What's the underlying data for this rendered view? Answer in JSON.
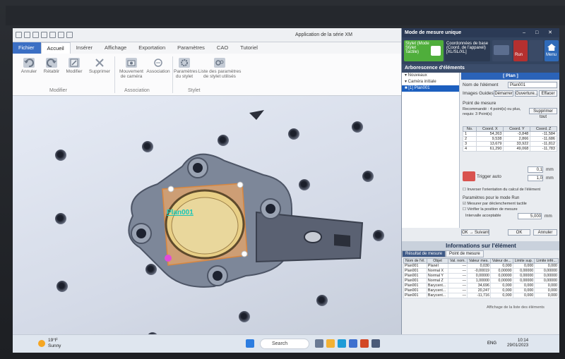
{
  "window": {
    "title": "Application de la série XM"
  },
  "ribbon": {
    "tabs": [
      "Fichier",
      "Accueil",
      "Insérer",
      "Affichage",
      "Exportation",
      "Paramètres",
      "CAO",
      "Tutoriel"
    ],
    "active_tab": "Accueil",
    "buttons": {
      "annuler": "Annuler",
      "retablir": "Rétablir",
      "modifier": "Modifier",
      "supprimer": "Supprimer",
      "mouvement_camera": "Mouvement de caméra",
      "association": "Association",
      "param_stylet": "Paramètres du stylet",
      "liste_param": "Liste des paramètres de stylet utilisés"
    },
    "groups": {
      "modifier": "Modifier",
      "association": "Association",
      "stylet": "Stylet"
    }
  },
  "viewport": {
    "element_label": "Plan001"
  },
  "panel": {
    "title": "Mode de mesure unique",
    "controls": "–  □  ✕",
    "tools": {
      "stylet_label": "Stylet (Mode Stylet Tactile)",
      "coords_label": "Coordonnées de base (Coord. de l'appareil) [XL/SL/XL]",
      "run": "Run",
      "menu": "Menu"
    },
    "tree_header": "Arborescence d'éléments",
    "tree": [
      "▾ Nouveaux",
      "   ▾ Caméra initiale",
      "      ■ [1] Plan001"
    ],
    "element_type": "[ Plan ]",
    "labels": {
      "nom": "Nom de l'élément",
      "nom_value": "Plan001",
      "guides": "Images Guides",
      "guide_btns": [
        "Démarrer",
        "Ouverture...",
        "Effacer"
      ],
      "point": "Point de mesure",
      "recommande": "Recommandé : 4 point(s) ou plus, requis: 3 Point(s)",
      "suppr": "Supprimer tout",
      "trigger": "Trigger auto",
      "inverser": "Inverser l'orientation du calcul de l'élément",
      "run_params": "Paramètres pour le mode Run",
      "mesurer": "Mesurer par déclenchement tactile",
      "verifier": "Vérifier la position de mesure",
      "intervalle": "Intervalle acceptable",
      "intervalle_val": "5,000",
      "unit": "mm",
      "ok_suivant": "OK → Suivant",
      "ok": "OK",
      "annuler": "Annuler",
      "spec1": "0,1",
      "spec2": "1,0"
    },
    "point_table": {
      "headers": [
        "No.",
        "Coord. X",
        "Coord. Y",
        "Coord. Z"
      ],
      "rows": [
        [
          "1",
          "54,263",
          "-3,848",
          "-11,584"
        ],
        [
          "2",
          "9,538",
          "2,866",
          "-11,686"
        ],
        [
          "3",
          "13,679",
          "33,922",
          "-11,812"
        ],
        [
          "4",
          "61,290",
          "49,068",
          "-11,783"
        ]
      ]
    },
    "info": {
      "header": "Informations sur l'élément",
      "tabs": [
        "Résultat de mesure",
        "Point de mesure"
      ],
      "headers": [
        "Nom de l'él.",
        "Objet",
        "Val. nom.",
        "Valeur mes.",
        "Valeur de...",
        "Limite sup.",
        "Limite infé..."
      ],
      "rows": [
        [
          "Plan001",
          "PlanéI",
          "—",
          "0,030",
          "0,000",
          "0,000",
          "0,000"
        ],
        [
          "Plan001",
          "Normal X",
          "—",
          "-0,00019",
          "0,00000",
          "0,00000",
          "0,00000"
        ],
        [
          "Plan001",
          "Normal Y",
          "—",
          "0,00000",
          "0,00000",
          "0,00000",
          "0,00000"
        ],
        [
          "Plan001",
          "Normal Z",
          "—",
          "1,00000",
          "0,00000",
          "0,00000",
          "0,00000"
        ],
        [
          "Plan001",
          "Barycent...",
          "—",
          "34,696",
          "0,000",
          "0,000",
          "0,000"
        ],
        [
          "Plan001",
          "Barycent...",
          "—",
          "20,247",
          "0,000",
          "0,000",
          "0,000"
        ],
        [
          "Plan001",
          "Barycent...",
          "—",
          "-11,716",
          "0,000",
          "0,000",
          "0,000"
        ]
      ],
      "footer": "Affichage de la liste des éléments"
    }
  },
  "taskbar": {
    "search": "Search",
    "weather_temp": "19°F",
    "weather_text": "Sunny",
    "time": "10:14",
    "date": "29/01/2023",
    "lang": "ENG"
  }
}
